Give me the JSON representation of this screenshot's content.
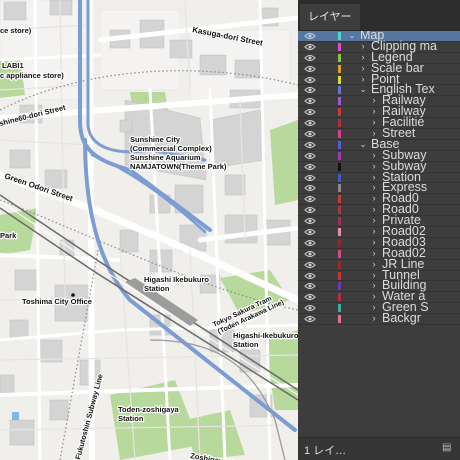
{
  "map": {
    "labels": {
      "store1": "ce store)",
      "labi1": "LABI1",
      "appliance": "c appliance store)",
      "kasuga": "Kasuga-dori Street",
      "sunshine60": "shine60-dori Street",
      "sunshine_city": "Sunshine City",
      "commercial": "(Commercial Complex)",
      "aquarium": "Sunshine Aquarium",
      "namjatown": "NAMJATOWN(Theme Park)",
      "green_odori": "Green Odori Street",
      "park": "Park",
      "higashi_station": "Higashi Ikebukuro",
      "station_word1": "Station",
      "toshima_office": "Toshima City Office",
      "tram_line1": "Tokyo Sakura Tram",
      "tram_line2": "(Toden Arakawa Line)",
      "higashi_sta2": "Higashi-Ikebukuro",
      "station_word2": "Station",
      "zoshigaya1": "Toden-zoshigaya",
      "zoshigaya2": "Station",
      "subway_line": "Fukutoshin Subway Line",
      "cemetery": "Zoshigaya Cemetery"
    }
  },
  "layers_panel": {
    "tab_label": "レイヤー",
    "footer_count": "1 レイ…",
    "layers": [
      {
        "name": "Map",
        "indent": 0,
        "expanded": true,
        "selected": true,
        "color": "#4fd4d6"
      },
      {
        "name": "Clipping ma",
        "indent": 1,
        "expanded": false,
        "selected": false,
        "color": "#d94fd1"
      },
      {
        "name": "Legend",
        "indent": 1,
        "expanded": false,
        "selected": false,
        "color": "#8cc43c"
      },
      {
        "name": "Scale bar",
        "indent": 1,
        "expanded": false,
        "selected": false,
        "color": "#e0a030"
      },
      {
        "name": "Point",
        "indent": 1,
        "expanded": false,
        "selected": false,
        "color": "#d9d640"
      },
      {
        "name": "English Tex",
        "indent": 1,
        "expanded": true,
        "selected": false,
        "color": "#5a7bd8"
      },
      {
        "name": "Railway",
        "indent": 2,
        "expanded": false,
        "selected": false,
        "color": "#9b5bd6"
      },
      {
        "name": "Railway",
        "indent": 2,
        "expanded": false,
        "selected": false,
        "color": "#c83c3c"
      },
      {
        "name": "Facilitie",
        "indent": 2,
        "expanded": false,
        "selected": false,
        "color": "#a8323c"
      },
      {
        "name": "Street",
        "indent": 2,
        "expanded": false,
        "selected": false,
        "color": "#d6408c"
      },
      {
        "name": "Base",
        "indent": 1,
        "expanded": true,
        "selected": false,
        "color": "#5060d0"
      },
      {
        "name": "Subway",
        "indent": 2,
        "expanded": false,
        "selected": false,
        "color": "#a03ab0"
      },
      {
        "name": "Subway",
        "indent": 2,
        "expanded": false,
        "selected": false,
        "color": "#111111"
      },
      {
        "name": "Station",
        "indent": 2,
        "expanded": false,
        "selected": false,
        "color": "#3a5ec8"
      },
      {
        "name": "Express",
        "indent": 2,
        "expanded": false,
        "selected": false,
        "color": "#8b8b8b"
      },
      {
        "name": "Road0",
        "indent": 2,
        "expanded": false,
        "selected": false,
        "color": "#c04040"
      },
      {
        "name": "Road0",
        "indent": 2,
        "expanded": false,
        "selected": false,
        "color": "#b03838"
      },
      {
        "name": "Private",
        "indent": 2,
        "expanded": false,
        "selected": false,
        "color": "#a03060"
      },
      {
        "name": "Road02",
        "indent": 2,
        "expanded": false,
        "selected": false,
        "color": "#e090b0"
      },
      {
        "name": "Road03",
        "indent": 2,
        "expanded": false,
        "selected": false,
        "color": "#8a2a2a"
      },
      {
        "name": "Road02",
        "indent": 2,
        "expanded": false,
        "selected": false,
        "color": "#d4507c"
      },
      {
        "name": "JR Line",
        "indent": 2,
        "expanded": false,
        "selected": false,
        "color": "#9a2a2a"
      },
      {
        "name": "Tunnel",
        "indent": 2,
        "expanded": false,
        "selected": false,
        "color": "#c03838"
      },
      {
        "name": "Building",
        "indent": 2,
        "expanded": false,
        "selected": false,
        "color": "#6a3ab8"
      },
      {
        "name": "Water a",
        "indent": 2,
        "expanded": false,
        "selected": false,
        "color": "#b83040"
      },
      {
        "name": "Green S",
        "indent": 2,
        "expanded": false,
        "selected": false,
        "color": "#3ab0a8"
      },
      {
        "name": "Backgr",
        "indent": 2,
        "expanded": false,
        "selected": false,
        "color": "#e0709a"
      }
    ]
  }
}
